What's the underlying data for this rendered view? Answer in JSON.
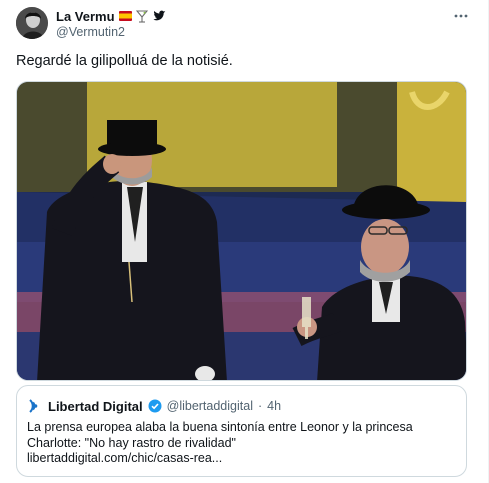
{
  "author": {
    "display_name": "La Vermu",
    "handle": "@Vermutin2",
    "badges": [
      "spain-flag-icon",
      "cocktail-glass-icon",
      "bird-icon"
    ]
  },
  "more_icon": "more-horizontal-icon",
  "tweet": {
    "text": "Regardé la gilipolluá de la notisié."
  },
  "quote": {
    "source_name": "Libertad Digital",
    "source_handle": "@libertaddigital",
    "separator": "·",
    "time": "4h",
    "headline_line1": "La prensa europea alaba la buena sintonía entre Leonor y la princesa",
    "headline_line2": "Charlotte: \"No hay rastro de rivalidad\"",
    "link": "libertaddigital.com/chic/casas-rea..."
  },
  "colors": {
    "text": "#0f1419",
    "muted": "#536471",
    "border": "#cfd9de",
    "verified": "#1d9bf0",
    "brand_blue": "#1a73c9"
  }
}
